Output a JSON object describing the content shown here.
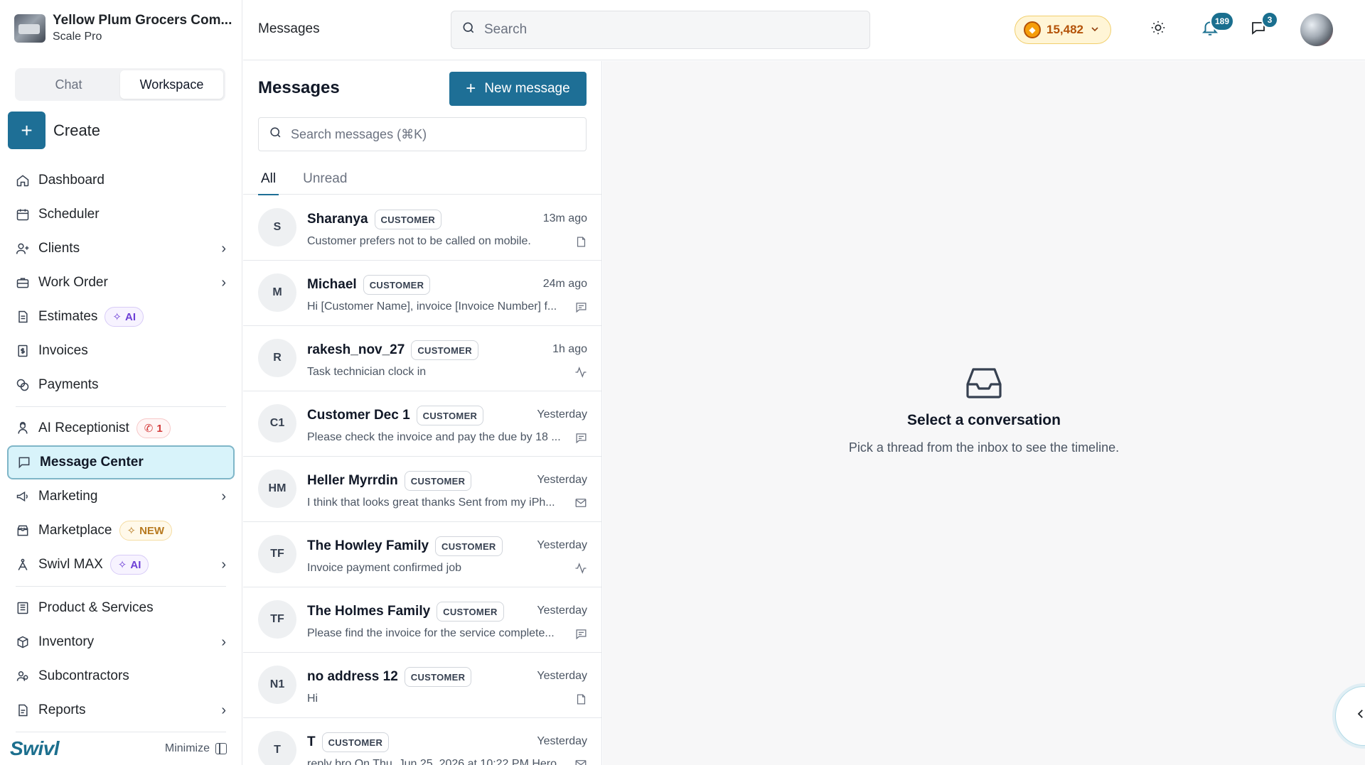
{
  "org": {
    "name": "Yellow Plum Grocers Com...",
    "plan": "Scale Pro"
  },
  "sidebar": {
    "segment": {
      "chat": "Chat",
      "workspace": "Workspace",
      "active": "Workspace"
    },
    "create_label": "Create",
    "items": [
      {
        "label": "Dashboard",
        "icon": "home-icon"
      },
      {
        "label": "Scheduler",
        "icon": "calendar-icon"
      },
      {
        "label": "Clients",
        "icon": "user-plus-icon",
        "chevron": true
      },
      {
        "label": "Work Order",
        "icon": "briefcase-icon",
        "chevron": true
      },
      {
        "label": "Estimates",
        "icon": "document-icon",
        "badge": "AI"
      },
      {
        "label": "Invoices",
        "icon": "invoice-icon"
      },
      {
        "label": "Payments",
        "icon": "coins-icon"
      },
      {
        "label": "AI Receptionist",
        "icon": "receptionist-icon",
        "badge": "1"
      },
      {
        "label": "Message Center",
        "icon": "message-icon",
        "active": true
      },
      {
        "label": "Marketing",
        "icon": "megaphone-icon",
        "chevron": true
      },
      {
        "label": "Marketplace",
        "icon": "store-icon",
        "badge": "NEW"
      },
      {
        "label": "Swivl MAX",
        "icon": "swivl-max-icon",
        "badge": "AI",
        "chevron": true
      },
      {
        "label": "Product & Services",
        "icon": "catalog-icon"
      },
      {
        "label": "Inventory",
        "icon": "box-icon",
        "chevron": true
      },
      {
        "label": "Subcontractors",
        "icon": "users-icon"
      },
      {
        "label": "Reports",
        "icon": "report-icon",
        "chevron": true
      }
    ],
    "footer": {
      "logo": "Swivl",
      "minimize": "Minimize"
    }
  },
  "topbar": {
    "title": "Messages",
    "search_placeholder": "Search",
    "credits": "15,482",
    "notifications_count": "189",
    "chat_count": "3"
  },
  "messages": {
    "title": "Messages",
    "new_message": "New message",
    "search_placeholder": "Search messages (⌘K)",
    "tabs": [
      "All",
      "Unread"
    ],
    "active_tab": "All",
    "threads": [
      {
        "initials": "S",
        "name": "Sharanya",
        "tag": "CUSTOMER",
        "time": "13m ago",
        "preview": "Customer prefers not to be called on mobile.",
        "channel": "note-icon"
      },
      {
        "initials": "M",
        "name": "Michael",
        "tag": "CUSTOMER",
        "time": "24m ago",
        "preview": "Hi [Customer Name], invoice [Invoice Number] f...",
        "channel": "sms-icon"
      },
      {
        "initials": "R",
        "name": "rakesh_nov_27",
        "tag": "CUSTOMER",
        "time": "1h ago",
        "preview": "Task technician clock in",
        "channel": "activity-icon"
      },
      {
        "initials": "C1",
        "name": "Customer Dec 1",
        "tag": "CUSTOMER",
        "time": "Yesterday",
        "preview": "Please check the invoice and pay the due by 18 ...",
        "channel": "sms-icon"
      },
      {
        "initials": "HM",
        "name": "Heller Myrrdin",
        "tag": "CUSTOMER",
        "time": "Yesterday",
        "preview": "I think that looks great thanks Sent from my iPh...",
        "channel": "email-icon"
      },
      {
        "initials": "TF",
        "name": "The Howley Family",
        "tag": "CUSTOMER",
        "time": "Yesterday",
        "preview": "Invoice payment confirmed job",
        "channel": "activity-icon"
      },
      {
        "initials": "TF",
        "name": "The Holmes Family",
        "tag": "CUSTOMER",
        "time": "Yesterday",
        "preview": "Please find the invoice for the service complete...",
        "channel": "sms-icon"
      },
      {
        "initials": "N1",
        "name": "no address 12",
        "tag": "CUSTOMER",
        "time": "Yesterday",
        "preview": "Hi",
        "channel": "note-icon"
      },
      {
        "initials": "T",
        "name": "T",
        "tag": "CUSTOMER",
        "time": "Yesterday",
        "preview": "reply bro On Thu, Jun 25, 2026 at 10:22 PM Hero",
        "channel": "email-icon"
      }
    ]
  },
  "conversation": {
    "empty_title": "Select a conversation",
    "empty_subtitle": "Pick a thread from the inbox to see the timeline."
  },
  "colors": {
    "primary": "#1e6f96",
    "active_nav_bg": "#d8f3fa",
    "ai_badge": "#6d3fd6",
    "new_badge": "#b7791f",
    "call_badge": "#d33a3a"
  }
}
